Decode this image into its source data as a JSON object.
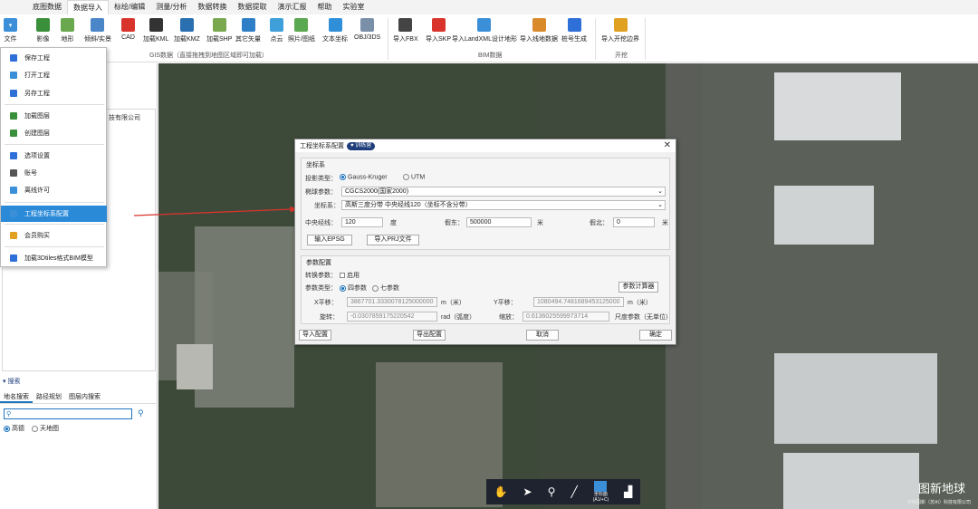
{
  "menubar": {
    "items": [
      {
        "label": "底图数据"
      },
      {
        "label": "数据导入"
      },
      {
        "label": "标绘/编辑"
      },
      {
        "label": "测量/分析"
      },
      {
        "label": "数据转换"
      },
      {
        "label": "数据提取"
      },
      {
        "label": "演示汇报"
      },
      {
        "label": "帮助"
      },
      {
        "label": "实验室"
      }
    ],
    "active_index": 1
  },
  "ribbon": {
    "file_label": "文件",
    "gis_tools": [
      {
        "label": "影像",
        "icon": "imagery-icon",
        "color": "#3a8f3a"
      },
      {
        "label": "地形",
        "icon": "terrain-icon",
        "color": "#6aa84f"
      },
      {
        "label": "倾斜/实景",
        "icon": "oblique-icon",
        "color": "#4a86c8"
      },
      {
        "label": "CAD",
        "icon": "cad-icon",
        "color": "#d9342b"
      },
      {
        "label": "加载KML",
        "icon": "kml-icon",
        "color": "#333333"
      },
      {
        "label": "加载KMZ",
        "icon": "kmz-icon",
        "color": "#2a6fb0"
      },
      {
        "label": "加载SHP",
        "icon": "shp-icon",
        "color": "#7aa84f"
      },
      {
        "label": "其它矢量",
        "icon": "vector-icon",
        "color": "#2f7fc8"
      },
      {
        "label": "点云",
        "icon": "pointcloud-icon",
        "color": "#3f9fd8"
      },
      {
        "label": "照片/图纸",
        "icon": "photo-icon",
        "color": "#5aa84f"
      },
      {
        "label": "文本坐标",
        "icon": "text-coord-icon",
        "color": "#2f8fd8"
      },
      {
        "label": "OBJ/3DS",
        "icon": "obj-icon",
        "color": "#7a8fa8"
      }
    ],
    "gis_group_label": "GIS数据（直接拖拽到地图区域即可加载）",
    "bim_tools": [
      {
        "label": "导入FBX",
        "icon": "fbx-icon",
        "color": "#444444"
      },
      {
        "label": "导入SKP",
        "icon": "skp-icon",
        "color": "#d9342b"
      },
      {
        "label": "导入LandXML设计地形",
        "icon": "landxml-icon",
        "color": "#3a8fd8"
      },
      {
        "label": "导入线地数据",
        "icon": "line-data-icon",
        "color": "#d98a2b"
      },
      {
        "label": "桩号生成",
        "icon": "station-icon",
        "color": "#2f6fd8"
      }
    ],
    "bim_group_label": "BIM数据",
    "dig_tools": [
      {
        "label": "导入开挖边界",
        "icon": "excavation-icon",
        "color": "#e0a020"
      }
    ],
    "dig_group_label": "开挖"
  },
  "file_menu": {
    "items": [
      {
        "label": "保存工程",
        "icon": "save-icon",
        "color": "#2f6fd8"
      },
      {
        "label": "打开工程",
        "icon": "open-icon",
        "color": "#3a8fd8"
      },
      {
        "label": "另存工程",
        "icon": "save-as-icon",
        "color": "#2f6fd8"
      },
      {
        "label": "加载图层",
        "icon": "load-layer-icon",
        "color": "#3a8f3a"
      },
      {
        "label": "创建图层",
        "icon": "create-layer-icon",
        "color": "#3a8f3a"
      },
      {
        "label": "选项设置",
        "icon": "settings-icon",
        "color": "#2f6fd8"
      },
      {
        "label": "账号",
        "icon": "account-icon",
        "color": "#555555"
      },
      {
        "label": "离线许可",
        "icon": "license-icon",
        "color": "#3a8fd8"
      },
      {
        "label": "工程坐标系配置",
        "icon": "coord-config-icon",
        "color": "#3a8fd8"
      },
      {
        "label": "会员购买",
        "icon": "member-icon",
        "color": "#e0a020"
      },
      {
        "label": "加载3Dtiles格式BIM模型",
        "icon": "bim-model-icon",
        "color": "#2f6fd8"
      }
    ],
    "active_index": 8
  },
  "left_panel": {
    "tree_fragment": "技有限公司",
    "search_title": "搜索",
    "search_tabs": [
      {
        "label": "地名搜索"
      },
      {
        "label": "路径规划"
      },
      {
        "label": "图层内搜索"
      }
    ],
    "search_value": "",
    "source_options": [
      {
        "label": "高德",
        "selected": true
      },
      {
        "label": "天地图",
        "selected": false
      }
    ]
  },
  "dialog": {
    "title": "工程坐标系配置",
    "badge": "训练营",
    "coord_section": {
      "title": "坐标系",
      "projection_label": "投影类型：",
      "projection_options": [
        {
          "label": "Gauss-Kruger",
          "selected": true
        },
        {
          "label": "UTM",
          "selected": false
        }
      ],
      "ellipsoid_label": "椭球参数：",
      "ellipsoid_value": "CGCS2000(国家2000)",
      "coord_label": "坐标系：",
      "coord_value": "高斯三度分带 中央经线120（坐标不含分带）",
      "central_meridian_label": "中央经线：",
      "central_meridian_value": "120",
      "central_meridian_unit": "度",
      "false_east_label": "假东：",
      "false_east_value": "500000",
      "false_east_unit": "米",
      "false_north_label": "假北：",
      "false_north_value": "0",
      "false_north_unit": "米",
      "import_epsg": "输入EPSG",
      "import_prj": "导入PRJ文件"
    },
    "param_section": {
      "title": "参数配置",
      "convert_label": "转换参数：",
      "enable_label": "启用",
      "param_type_label": "参数类型：",
      "param_options": [
        {
          "label": "四参数",
          "selected": true
        },
        {
          "label": "七参数",
          "selected": false
        }
      ],
      "calc_button": "参数计算器",
      "x_shift_label": "X平移：",
      "x_shift_value": "3867701.3330078125000000",
      "x_shift_unit": "m（米）",
      "y_shift_label": "Y平移：",
      "y_shift_value": "1080494.7481689453125000",
      "y_shift_unit": "m（米）",
      "rotation_label": "旋转：",
      "rotation_value": "-0.0307859175220542",
      "rotation_unit": "rad（弧度）",
      "scale_label": "缩放：",
      "scale_value": "0.6136025599973714",
      "scale_unit": "尺度参数（无单位）"
    },
    "buttons": {
      "import_config": "导入配置",
      "export_config": "导出配置",
      "cancel": "取消",
      "ok": "确定"
    }
  },
  "map": {
    "logo": "图新地球",
    "logo_sub": "中科图新（苏州）科技有限公司",
    "toolbar_label_1": "坐标面",
    "toolbar_label_2": "(A1/+C)"
  },
  "colors": {
    "accent": "#2a8ad8",
    "dialog_badge": "#1e3d7a",
    "arrow": "#d9342b"
  }
}
